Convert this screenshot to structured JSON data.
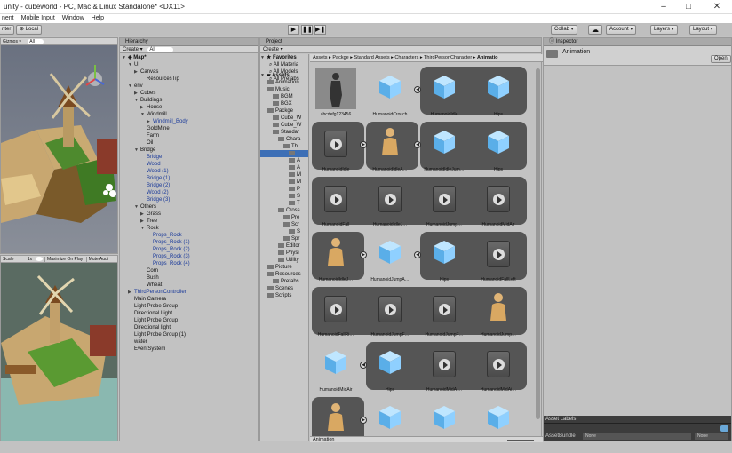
{
  "window": {
    "title": "unity - cubeworld - PC, Mac & Linux Standalone* <DX11>"
  },
  "menu": [
    "nent",
    "Mobile Input",
    "Window",
    "Help"
  ],
  "toolbar": {
    "center": "nter",
    "local": "Local",
    "collab": "Collab ▾",
    "account": "Account ▾",
    "layers": "Layers ▾",
    "layout": "Layout ▾"
  },
  "scene": {
    "gizmos": "Gizmos ▾",
    "search": "All"
  },
  "game": {
    "scale": "Scale",
    "scale_val": "1x",
    "maximize": "Maximize On Play",
    "mute": "Mute Audi"
  },
  "hierarchy": {
    "tab": "Hierarchy",
    "create": "Create ▾",
    "search": "All",
    "scene": "Map*",
    "items": [
      {
        "t": "UI",
        "d": 1,
        "a": "▼"
      },
      {
        "t": "Canvas",
        "d": 2,
        "a": "▶"
      },
      {
        "t": "ResourcesTip",
        "d": 3,
        "a": ""
      },
      {
        "t": "env",
        "d": 1,
        "a": "▼"
      },
      {
        "t": "Cubes",
        "d": 2,
        "a": "▶"
      },
      {
        "t": "Buildings",
        "d": 2,
        "a": "▼"
      },
      {
        "t": "House",
        "d": 3,
        "a": "▶"
      },
      {
        "t": "Windmill",
        "d": 3,
        "a": "▼"
      },
      {
        "t": "Windmill_Body",
        "d": 4,
        "a": "▶",
        "c": "blue"
      },
      {
        "t": "GoldMine",
        "d": 3,
        "a": ""
      },
      {
        "t": "Farm",
        "d": 3,
        "a": ""
      },
      {
        "t": "Oil",
        "d": 3,
        "a": ""
      },
      {
        "t": "Bridge",
        "d": 2,
        "a": "▼"
      },
      {
        "t": "Bridge",
        "d": 3,
        "a": "",
        "c": "blue"
      },
      {
        "t": "Wood",
        "d": 3,
        "a": "",
        "c": "blue"
      },
      {
        "t": "Wood (1)",
        "d": 3,
        "a": "",
        "c": "blue"
      },
      {
        "t": "Bridge (1)",
        "d": 3,
        "a": "",
        "c": "blue"
      },
      {
        "t": "Bridge (2)",
        "d": 3,
        "a": "",
        "c": "blue"
      },
      {
        "t": "Wood (2)",
        "d": 3,
        "a": "",
        "c": "blue"
      },
      {
        "t": "Bridge (3)",
        "d": 3,
        "a": "",
        "c": "blue"
      },
      {
        "t": "Others",
        "d": 2,
        "a": "▼"
      },
      {
        "t": "Grass",
        "d": 3,
        "a": "▶"
      },
      {
        "t": "Tree",
        "d": 3,
        "a": "▶"
      },
      {
        "t": "Rock",
        "d": 3,
        "a": "▼"
      },
      {
        "t": "Props_Rock",
        "d": 4,
        "a": "",
        "c": "blue"
      },
      {
        "t": "Props_Rock (1)",
        "d": 4,
        "a": "",
        "c": "blue"
      },
      {
        "t": "Props_Rock (2)",
        "d": 4,
        "a": "",
        "c": "blue"
      },
      {
        "t": "Props_Rock (3)",
        "d": 4,
        "a": "",
        "c": "blue"
      },
      {
        "t": "Props_Rock (4)",
        "d": 4,
        "a": "",
        "c": "blue"
      },
      {
        "t": "Corn",
        "d": 3,
        "a": ""
      },
      {
        "t": "Bush",
        "d": 3,
        "a": ""
      },
      {
        "t": "Wheat",
        "d": 3,
        "a": ""
      },
      {
        "t": "ThirdPersonController",
        "d": 1,
        "a": "▶",
        "c": "blue"
      },
      {
        "t": "Main Camera",
        "d": 1,
        "a": ""
      },
      {
        "t": "Light Probe Group",
        "d": 1,
        "a": ""
      },
      {
        "t": "Directional Light",
        "d": 1,
        "a": ""
      },
      {
        "t": "Light Probe Group",
        "d": 1,
        "a": ""
      },
      {
        "t": "Directional light",
        "d": 1,
        "a": ""
      },
      {
        "t": "Light Probe Group (1)",
        "d": 1,
        "a": ""
      },
      {
        "t": "water",
        "d": 1,
        "a": ""
      },
      {
        "t": "EventSystem",
        "d": 1,
        "a": ""
      }
    ]
  },
  "project": {
    "tab": "Project",
    "create": "Create ▾",
    "favorites": "Favorites",
    "fav_items": [
      "All Materia",
      "All Models",
      "All Prefabs"
    ],
    "assets": "Assets",
    "tree": [
      {
        "t": "Animation",
        "d": 1
      },
      {
        "t": "Music",
        "d": 1
      },
      {
        "t": "BGM",
        "d": 2
      },
      {
        "t": "BGX",
        "d": 2
      },
      {
        "t": "Packge",
        "d": 1
      },
      {
        "t": "Cube_W",
        "d": 2
      },
      {
        "t": "Cube_W",
        "d": 2
      },
      {
        "t": "Standar",
        "d": 2
      },
      {
        "t": "Chara",
        "d": 3
      },
      {
        "t": "Thi",
        "d": 4
      },
      {
        "t": "",
        "d": 5,
        "sel": true
      },
      {
        "t": "A",
        "d": 5
      },
      {
        "t": "A",
        "d": 5
      },
      {
        "t": "M",
        "d": 5
      },
      {
        "t": "M",
        "d": 5
      },
      {
        "t": "P",
        "d": 5
      },
      {
        "t": "S",
        "d": 5
      },
      {
        "t": "T",
        "d": 5
      },
      {
        "t": "Cross",
        "d": 3
      },
      {
        "t": "Pre",
        "d": 4
      },
      {
        "t": "Scr",
        "d": 4
      },
      {
        "t": "S",
        "d": 5
      },
      {
        "t": "Spr",
        "d": 4
      },
      {
        "t": "Editor",
        "d": 3
      },
      {
        "t": "Physi",
        "d": 3
      },
      {
        "t": "Utility",
        "d": 3
      },
      {
        "t": "Picture",
        "d": 1
      },
      {
        "t": "Resources",
        "d": 1
      },
      {
        "t": "Prefabs",
        "d": 2
      },
      {
        "t": "Scenes",
        "d": 1
      },
      {
        "t": "Scripts",
        "d": 1
      }
    ],
    "breadcrumb": [
      "Assets",
      "Packge",
      "Standard Assets",
      "Characters",
      "ThirdPersonCharacter",
      "Animatio"
    ],
    "footer": "Animation",
    "cells": [
      [
        "abcdefg123456",
        "HumanoidCrouch",
        "HumanoidIdle",
        "Hips"
      ],
      [
        "HumanoidIdle",
        "HumanoidIdleA…",
        "HumanoidIdleJum…",
        "Hips"
      ],
      [
        "HumanoidFall",
        "HumanoidIdleJ…",
        "HumanoidJump…",
        "HumanoidMidAir"
      ],
      [
        "HumanoidIdleJ…",
        "HumanoidJumpA…",
        "Hips",
        "HumanoidFallLeft"
      ],
      [
        "HumanoidFallRi…",
        "HumanoidJumpF…",
        "HumanoidJumpF…",
        "HumanoidJump…"
      ],
      [
        "HumanoidMidAir",
        "Hips",
        "HumanoidMidAi…",
        "HumanoidMidAi…"
      ],
      [
        "",
        "",
        "",
        ""
      ]
    ]
  },
  "inspector": {
    "tab": "Inspector",
    "name": "Animation",
    "open": "Open",
    "labels": "Asset Labels",
    "bundle": "AssetBundle",
    "none1": "None",
    "none2": "None"
  }
}
